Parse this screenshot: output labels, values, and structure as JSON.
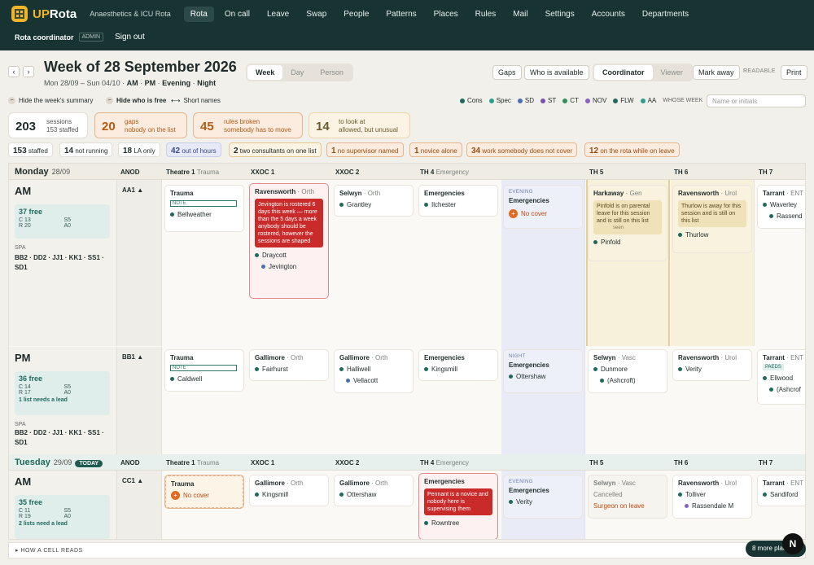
{
  "app": {
    "brand_a": "UP",
    "brand_b": "Rota",
    "subtitle": "Anaesthetics & ICU Rota"
  },
  "nav": [
    "Rota",
    "On call",
    "Leave",
    "Swap",
    "People",
    "Patterns",
    "Places",
    "Rules",
    "Mail",
    "Settings",
    "Accounts",
    "Departments"
  ],
  "user": {
    "role": "Rota coordinator",
    "badge": "ADMIN",
    "signout": "Sign out"
  },
  "week": {
    "title": "Week of 28 September 2026",
    "range": "Mon 28/09 – Sun 04/10",
    "filters": [
      "AM",
      "PM",
      "Evening",
      "Night"
    ]
  },
  "views": [
    "Week",
    "Day",
    "Person"
  ],
  "actions": {
    "gaps": "Gaps",
    "who": "Who is available",
    "coordinator": "Coordinator",
    "viewer": "Viewer",
    "mark": "Mark away",
    "readable": "READABLE",
    "print": "Print"
  },
  "toggles": {
    "summary": "Hide the week's summary",
    "free": "Hide who is free",
    "short": "Short names"
  },
  "legend": [
    {
      "k": "Cons",
      "c": "#1e6a5e"
    },
    {
      "k": "Spec",
      "c": "#2a9d8f"
    },
    {
      "k": "SD",
      "c": "#4a6fb5"
    },
    {
      "k": "ST",
      "c": "#7b4fb5"
    },
    {
      "k": "CT",
      "c": "#2f8f5b"
    },
    {
      "k": "NOV",
      "c": "#8a5fc4"
    },
    {
      "k": "FLW",
      "c": "#1e6a5e"
    },
    {
      "k": "AA",
      "c": "#2a9d8f"
    }
  ],
  "whose_week": "WHOSE WEEK",
  "search_ph": "Name or initials",
  "stats": {
    "sessions": "203",
    "sessions_l1": "sessions",
    "sessions_l2": "153 staffed",
    "gaps": "20",
    "gaps_l1": "gaps",
    "gaps_l2": "nobody on the list",
    "rules": "45",
    "rules_l1": "rules broken",
    "rules_l2": "somebody has to move",
    "look": "14",
    "look_l1": "to look at",
    "look_l2": "allowed, but unusual"
  },
  "chips": [
    {
      "n": "153",
      "t": "staffed"
    },
    {
      "n": "14",
      "t": "not running"
    },
    {
      "n": "18",
      "t": "LA only"
    },
    {
      "n": "42",
      "t": "out of hours"
    },
    {
      "n": "2",
      "t": "two consultants on one list"
    },
    {
      "n": "1",
      "t": "no supervisor named"
    },
    {
      "n": "1",
      "t": "novice alone"
    },
    {
      "n": "34",
      "t": "work somebody does not cover"
    },
    {
      "n": "12",
      "t": "on the rota while on leave"
    }
  ],
  "cols": [
    {
      "n": "Theatre 1",
      "s": "Trauma"
    },
    {
      "n": "XXOC 1",
      "s": ""
    },
    {
      "n": "XXOC 2",
      "s": ""
    },
    {
      "n": "TH 4",
      "s": "Emergency"
    },
    {
      "n": "",
      "s": ""
    },
    {
      "n": "TH 5",
      "s": ""
    },
    {
      "n": "TH 6",
      "s": ""
    },
    {
      "n": "TH 7",
      "s": ""
    }
  ],
  "anod": "ANOD",
  "mon": {
    "day": "Monday",
    "date": "28/09",
    "am": {
      "label": "AM",
      "anod": "AA1 ▲",
      "free": "37 free",
      "f1": "C 13",
      "f2": "S5",
      "f3": "R 20",
      "f4": "A0",
      "spa": "SPA",
      "spa_list": "BB2 · DD2 · JJ1 · KK1 · SS1 · SD1"
    },
    "pm": {
      "label": "PM",
      "anod": "BB1 ▲",
      "free": "36 free",
      "f1": "C 14",
      "f2": "S5",
      "f3": "R 17",
      "f4": "A0",
      "lead": "1 list needs a lead",
      "spa": "SPA",
      "spa_list": "BB2 · DD2 · JJ1 · KK1 · SS1 · SD1"
    }
  },
  "tue": {
    "day": "Tuesday",
    "date": "29/09",
    "today": "TODAY",
    "am": {
      "label": "AM",
      "anod": "CC1 ▲",
      "free": "35 free",
      "f1": "C 11",
      "f2": "S5",
      "f3": "R 19",
      "f4": "A0",
      "lead": "2 lists need a lead"
    }
  },
  "cards": {
    "m_a1": {
      "h": "Trauma",
      "note": "NOTE",
      "p": "Bellweather"
    },
    "m_a2": {
      "h": "Ravensworth",
      "s": "· Orth",
      "red": "Jevington is rostered 6 days this week — more than the 5 days a week anybody should be rostered, however the sessions are shaped",
      "p1": "Draycott",
      "p2": "Jevington"
    },
    "m_a3": {
      "h": "Selwyn",
      "s": "· Orth",
      "p": "Grantley"
    },
    "m_a4": {
      "h": "Emergencies",
      "p": "Ilchester"
    },
    "m_a5": {
      "eh": "EVENING",
      "h": "Emergencies",
      "nc": "No cover"
    },
    "m_a6": {
      "h": "Harkaway",
      "s": "· Gen",
      "amb": "Pinfold is on parental leave for this session and is still on this list",
      "seen": "seen",
      "p": "Pinfold"
    },
    "m_a7": {
      "h": "Ravensworth",
      "s": "· Urol",
      "amb": "Thurlow is away for this session and is still on this list",
      "p": "Thurlow"
    },
    "m_a8": {
      "h": "Tarrant",
      "s": "· ENT",
      "p1": "Waverley",
      "p2": "Rassend"
    },
    "m_p1": {
      "h": "Trauma",
      "note": "NOTE",
      "p": "Caldwell"
    },
    "m_p2": {
      "h": "Gallimore",
      "s": "· Orth",
      "p": "Fairhurst"
    },
    "m_p3": {
      "h": "Gallimore",
      "s": "· Orth",
      "p1": "Halliwell",
      "p2": "Vellacott"
    },
    "m_p4": {
      "h": "Emergencies",
      "p": "Kingsmill"
    },
    "m_p5": {
      "eh": "NIGHT",
      "h": "Emergencies",
      "p": "Ottershaw"
    },
    "m_p6": {
      "h": "Selwyn",
      "s": "· Vasc",
      "p1": "Dunmore",
      "p2": "(Ashcroft)"
    },
    "m_p7": {
      "h": "Ravensworth",
      "s": "· Urol",
      "p": "Verity"
    },
    "m_p8": {
      "h": "Tarrant",
      "s": "· ENT",
      "tag": "PAEDS",
      "p1": "Ellwood",
      "p2": "(Ashcrof"
    },
    "t_a1": {
      "h": "Trauma",
      "nc": "No cover"
    },
    "t_a2": {
      "h": "Gallimore",
      "s": "· Orth",
      "p": "Kingsmill"
    },
    "t_a3": {
      "h": "Gallimore",
      "s": "· Orth",
      "p": "Ottershaw"
    },
    "t_a4": {
      "h": "Emergencies",
      "red": "Pennant is a novice and nobody here is supervising them",
      "p": "Rowntree"
    },
    "t_a5": {
      "eh": "EVENING",
      "h": "Emergencies",
      "p": "Verity"
    },
    "t_a6": {
      "h": "Selwyn",
      "s": "· Vasc",
      "c": "Cancelled",
      "l": "Surgeon on leave"
    },
    "t_a7": {
      "h": "Ravensworth",
      "s": "· Urol",
      "p1": "Tolliver",
      "p2": "Rassendale M"
    },
    "t_a8": {
      "h": "Tarrant",
      "s": "· ENT",
      "p": "Sandiford"
    }
  },
  "footer": "▸ HOW A CELL READS",
  "more": "8 more places",
  "nbadge": "N"
}
